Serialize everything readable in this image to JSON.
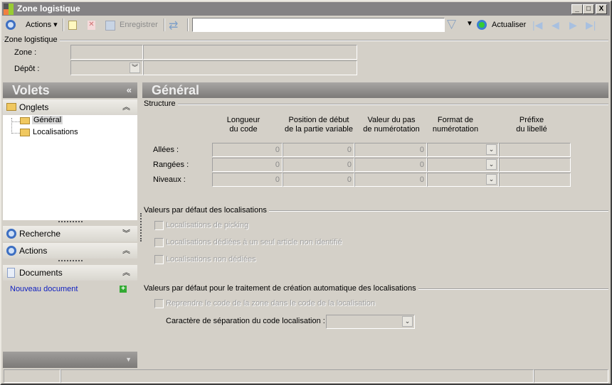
{
  "window": {
    "title": "Zone logistique",
    "minimize": "_",
    "maximize": "□",
    "close": "X"
  },
  "toolbar": {
    "actions_label": "Actions",
    "save_label": "Enregistrer",
    "search_value": "",
    "refresh_label": "Actualiser"
  },
  "header": {
    "group_title": "Zone logistique",
    "zone_label": "Zone :",
    "depot_label": "Dépôt :",
    "zone_value": "",
    "depot_value": ""
  },
  "left": {
    "title": "Volets",
    "collapse": "«",
    "onglets": {
      "label": "Onglets",
      "items": [
        {
          "label": "Général"
        },
        {
          "label": "Localisations"
        }
      ]
    },
    "recherche": "Recherche",
    "actions": "Actions",
    "documents": "Documents",
    "new_document": "Nouveau document"
  },
  "main": {
    "title": "Général",
    "structure": "Structure",
    "columns": [
      "Longueur\ndu code",
      "Position de début\nde la partie variable",
      "Valeur du pas\nde numérotation",
      "Format de\nnumérotation",
      "Préfixe\ndu libellé"
    ],
    "rows": [
      {
        "label": "Allées :",
        "values": [
          "0",
          "0",
          "0"
        ]
      },
      {
        "label": "Rangées :",
        "values": [
          "0",
          "0",
          "0"
        ]
      },
      {
        "label": "Niveaux :",
        "values": [
          "0",
          "0",
          "0"
        ]
      }
    ],
    "defaults_title": "Valeurs par défaut des localisations",
    "checkboxes": [
      {
        "label": "Localisations de picking",
        "checked": false
      },
      {
        "label": "Localisations dédiées à un seul article non identifié",
        "checked": false
      },
      {
        "label": "Localisations non dédiées",
        "checked": false
      }
    ],
    "auto_title": "Valeurs par défaut pour le traitement de création automatique des localisations",
    "auto_checkbox": {
      "label": "Reprendre le code de la zone dans le code de la localisation",
      "checked": false
    },
    "separator_label": "Caractère de séparation du code localisation :",
    "separator_value": ""
  }
}
